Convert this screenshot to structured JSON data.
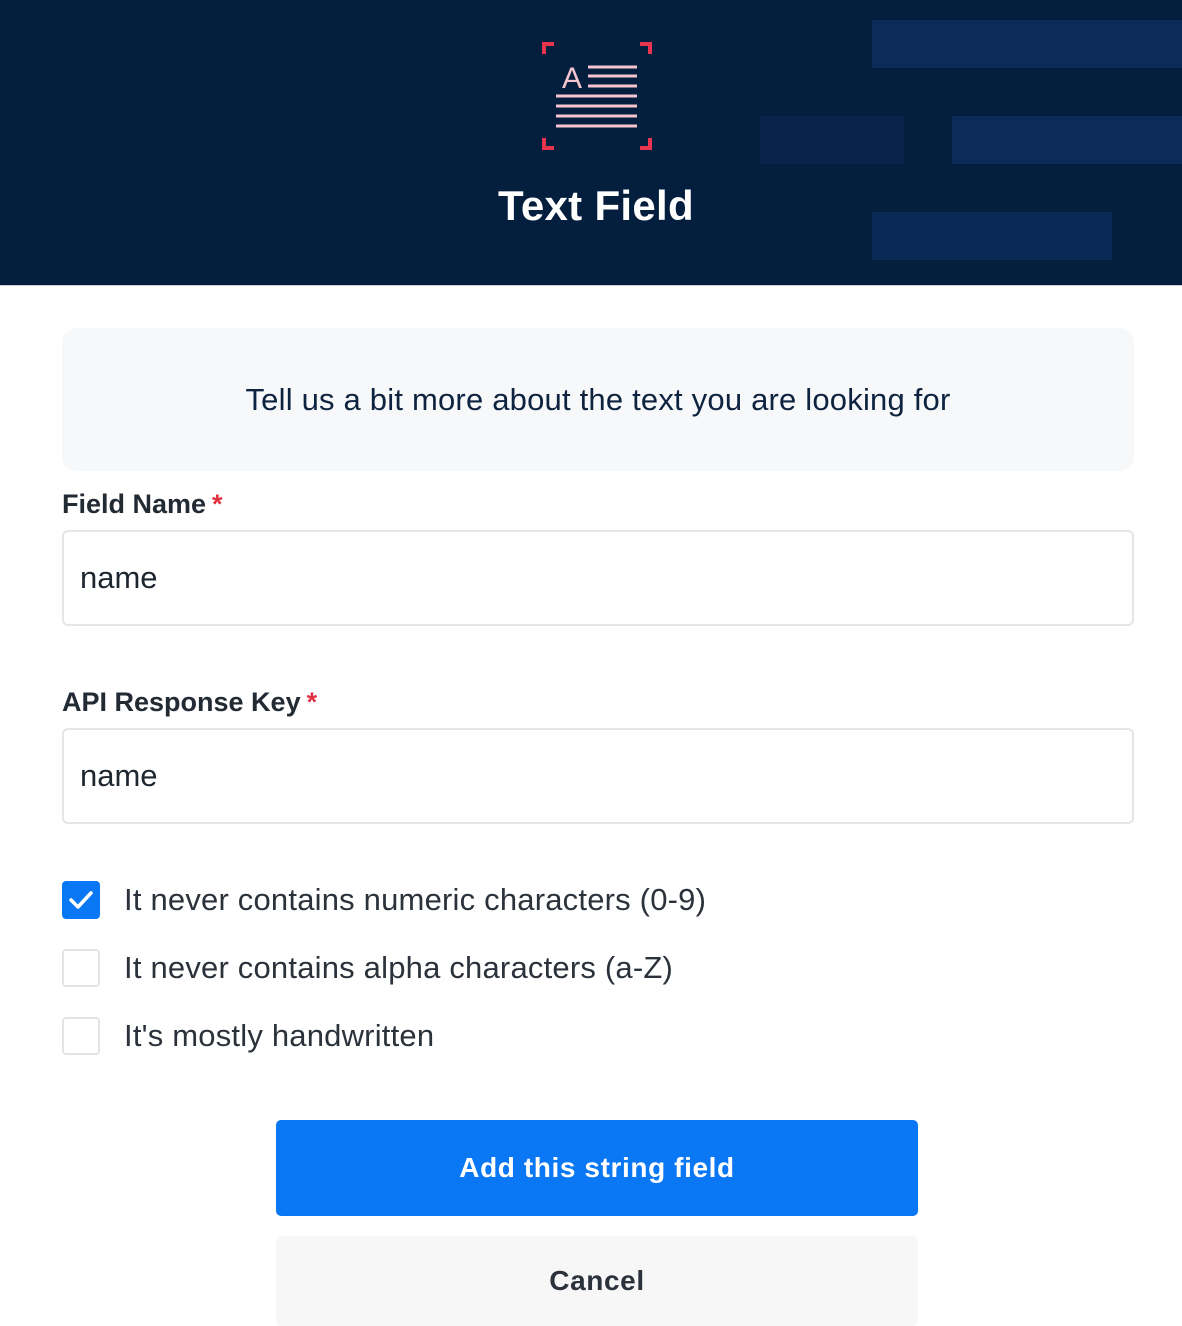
{
  "header": {
    "title": "Text Field",
    "icon": "text-field-icon",
    "background_color": "#041e3d"
  },
  "intro": {
    "text": "Tell us a bit more about the text you are looking for"
  },
  "form": {
    "field_name": {
      "label": "Field Name",
      "required_marker": "*",
      "value": "name"
    },
    "api_response_key": {
      "label": "API Response Key",
      "required_marker": "*",
      "value": "name"
    },
    "options": [
      {
        "label": "It never contains numeric characters (0-9)",
        "checked": true
      },
      {
        "label": "It never contains alpha characters (a-Z)",
        "checked": false
      },
      {
        "label": "It's mostly handwritten",
        "checked": false
      }
    ]
  },
  "actions": {
    "primary_label": "Add this string field",
    "cancel_label": "Cancel"
  },
  "colors": {
    "accent": "#0a78f4",
    "required": "#e0303f",
    "icon_corners": "#e8344e",
    "icon_lines": "#f4c4cf"
  }
}
